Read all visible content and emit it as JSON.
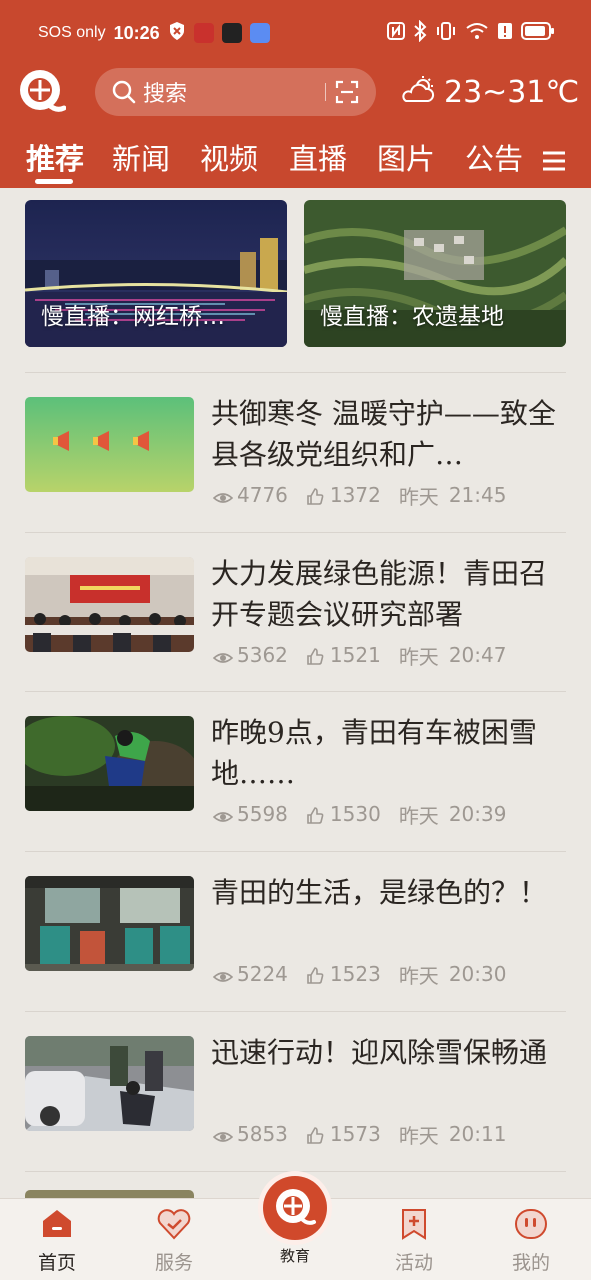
{
  "status_bar": {
    "carrier": "SOS only",
    "time": "10:26"
  },
  "header": {
    "search_placeholder": "搜索",
    "weather": "23~31℃"
  },
  "tabs": [
    {
      "label": "推荐",
      "active": true
    },
    {
      "label": "新闻"
    },
    {
      "label": "视频"
    },
    {
      "label": "直播"
    },
    {
      "label": "图片"
    },
    {
      "label": "公告"
    }
  ],
  "live_cards": [
    {
      "caption": "慢直播：网红桥…"
    },
    {
      "caption": "慢直播：农遗基地"
    }
  ],
  "news": [
    {
      "title": "共御寒冬 温暖守护——致全县各级党组织和广…",
      "views": "4776",
      "likes": "1372",
      "date": "昨天",
      "time": "21:45"
    },
    {
      "title": "大力发展绿色能源！青田召开专题会议研究部署",
      "views": "5362",
      "likes": "1521",
      "date": "昨天",
      "time": "20:47"
    },
    {
      "title": "昨晚9点，青田有车被困雪地……",
      "views": "5598",
      "likes": "1530",
      "date": "昨天",
      "time": "20:39"
    },
    {
      "title": "青田的生活，是绿色的？！",
      "views": "5224",
      "likes": "1523",
      "date": "昨天",
      "time": "20:30"
    },
    {
      "title": "迅速行动！迎风除雪保畅通",
      "views": "5853",
      "likes": "1573",
      "date": "昨天",
      "time": "20:11"
    }
  ],
  "bottom_nav": [
    {
      "label": "首页",
      "active": true
    },
    {
      "label": "服务"
    },
    {
      "label": "教育"
    },
    {
      "label": "活动"
    },
    {
      "label": "我的"
    }
  ],
  "colors": {
    "brand": "#c8482e",
    "background": "#ebe8e3",
    "meta_text": "#9e9892"
  }
}
